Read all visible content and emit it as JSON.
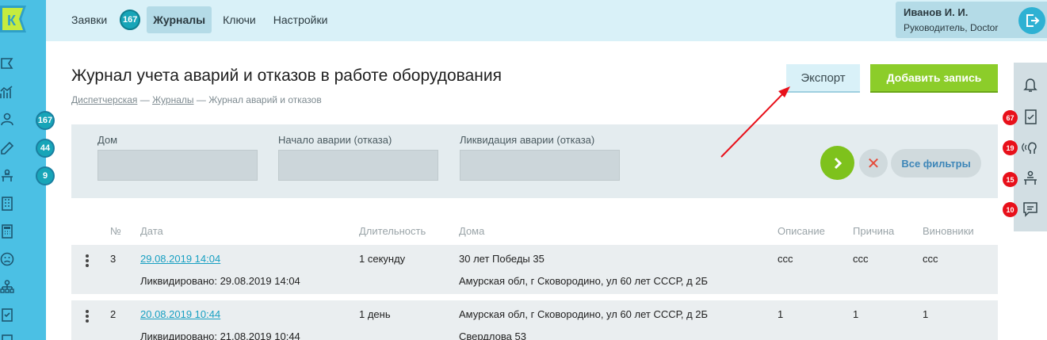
{
  "app": {
    "logo_letter": "К",
    "brand_color": "#4bc0e4",
    "accent_color": "#17a5b8"
  },
  "sidebar": {
    "items": [
      {
        "icon": "flag-icon",
        "badge": ""
      },
      {
        "icon": "chart-icon",
        "badge": ""
      },
      {
        "icon": "people-icon",
        "badge": "167"
      },
      {
        "icon": "edit-icon",
        "badge": "44"
      },
      {
        "icon": "desk-icon",
        "badge": "9"
      },
      {
        "icon": "building-icon",
        "badge": ""
      },
      {
        "icon": "calculator-icon",
        "badge": ""
      },
      {
        "icon": "face-icon",
        "badge": ""
      },
      {
        "icon": "org-icon",
        "badge": ""
      },
      {
        "icon": "clipboard-icon",
        "badge": ""
      }
    ]
  },
  "topbar": {
    "nav": [
      {
        "label": "Заявки",
        "badge": "167",
        "active": false
      },
      {
        "label": "Журналы",
        "badge": "",
        "active": true
      },
      {
        "label": "Ключи",
        "badge": "",
        "active": false
      },
      {
        "label": "Настройки",
        "badge": "",
        "active": false
      }
    ],
    "user": {
      "name": "Иванов И. И.",
      "role": "Руководитель, Doctor"
    }
  },
  "page": {
    "title": "Журнал учета аварий и отказов в работе оборудования",
    "breadcrumb": {
      "item1": "Диспетчерская",
      "sep": "—",
      "item2": "Журналы",
      "item3": "Журнал аварий и отказов"
    },
    "export_label": "Экспорт",
    "add_label": "Добавить запись"
  },
  "filters": {
    "house_label": "Дом",
    "start_label": "Начало аварии (отказа)",
    "end_label": "Ликвидация аварии (отказа)",
    "clear_symbol": "✕",
    "all_label": "Все фильтры"
  },
  "right_panel": [
    {
      "icon": "bell-icon",
      "badge": ""
    },
    {
      "icon": "clipboard-check-icon",
      "badge": "67"
    },
    {
      "icon": "speaker-head-icon",
      "badge": "19"
    },
    {
      "icon": "desk-icon",
      "badge": "15"
    },
    {
      "icon": "chat-icon",
      "badge": "10"
    }
  ],
  "table": {
    "headers": [
      "№",
      "Дата",
      "Длительность",
      "Дома",
      "Описание",
      "Причина",
      "Виновники"
    ],
    "rows": [
      {
        "num": "3",
        "date": "29.08.2019 14:04",
        "resolved": "Ликвидировано: 29.08.2019 14:04",
        "duration": "1 секунду",
        "house1": "30 лет Победы 35",
        "house2": "Амурская обл, г Сковородино, ул 60 лет СССР, д 2Б",
        "description": "ccc",
        "cause": "ccc",
        "culprits": "ccc"
      },
      {
        "num": "2",
        "date": "20.08.2019 10:44",
        "resolved": "Ликвидировано: 21.08.2019 10:44",
        "duration": "1 день",
        "house1": "Амурская обл, г Сковородино, ул 60 лет СССР, д 2Б",
        "house2": "Свердлова 53",
        "description": "1",
        "cause": "1",
        "culprits": "1"
      }
    ]
  }
}
